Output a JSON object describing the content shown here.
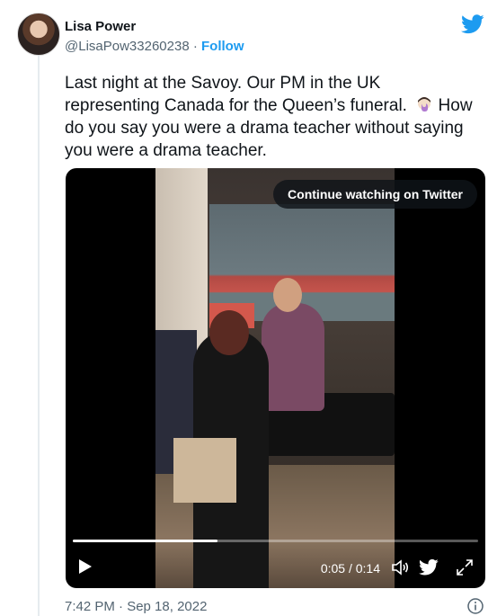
{
  "author": {
    "name": "Lisa Power",
    "handle": "@LisaPow33260238",
    "separator": "·",
    "follow_label": "Follow"
  },
  "tweet": {
    "text": "Last night at the Savoy. Our PM in the UK representing Canada for the Queen’s funeral.",
    "text_2": "How do you say you were a drama teacher without saying you were a drama teacher.",
    "emoji": "facepalm-emoji"
  },
  "video": {
    "continue_label": "Continue watching on Twitter",
    "time_display": "0:05 / 0:14",
    "progress": 0.357
  },
  "footer": {
    "timestamp": "7:42 PM · Sep 18, 2022"
  },
  "colors": {
    "accent": "#1d9bf0",
    "text": "#0f1419",
    "muted": "#536471"
  }
}
